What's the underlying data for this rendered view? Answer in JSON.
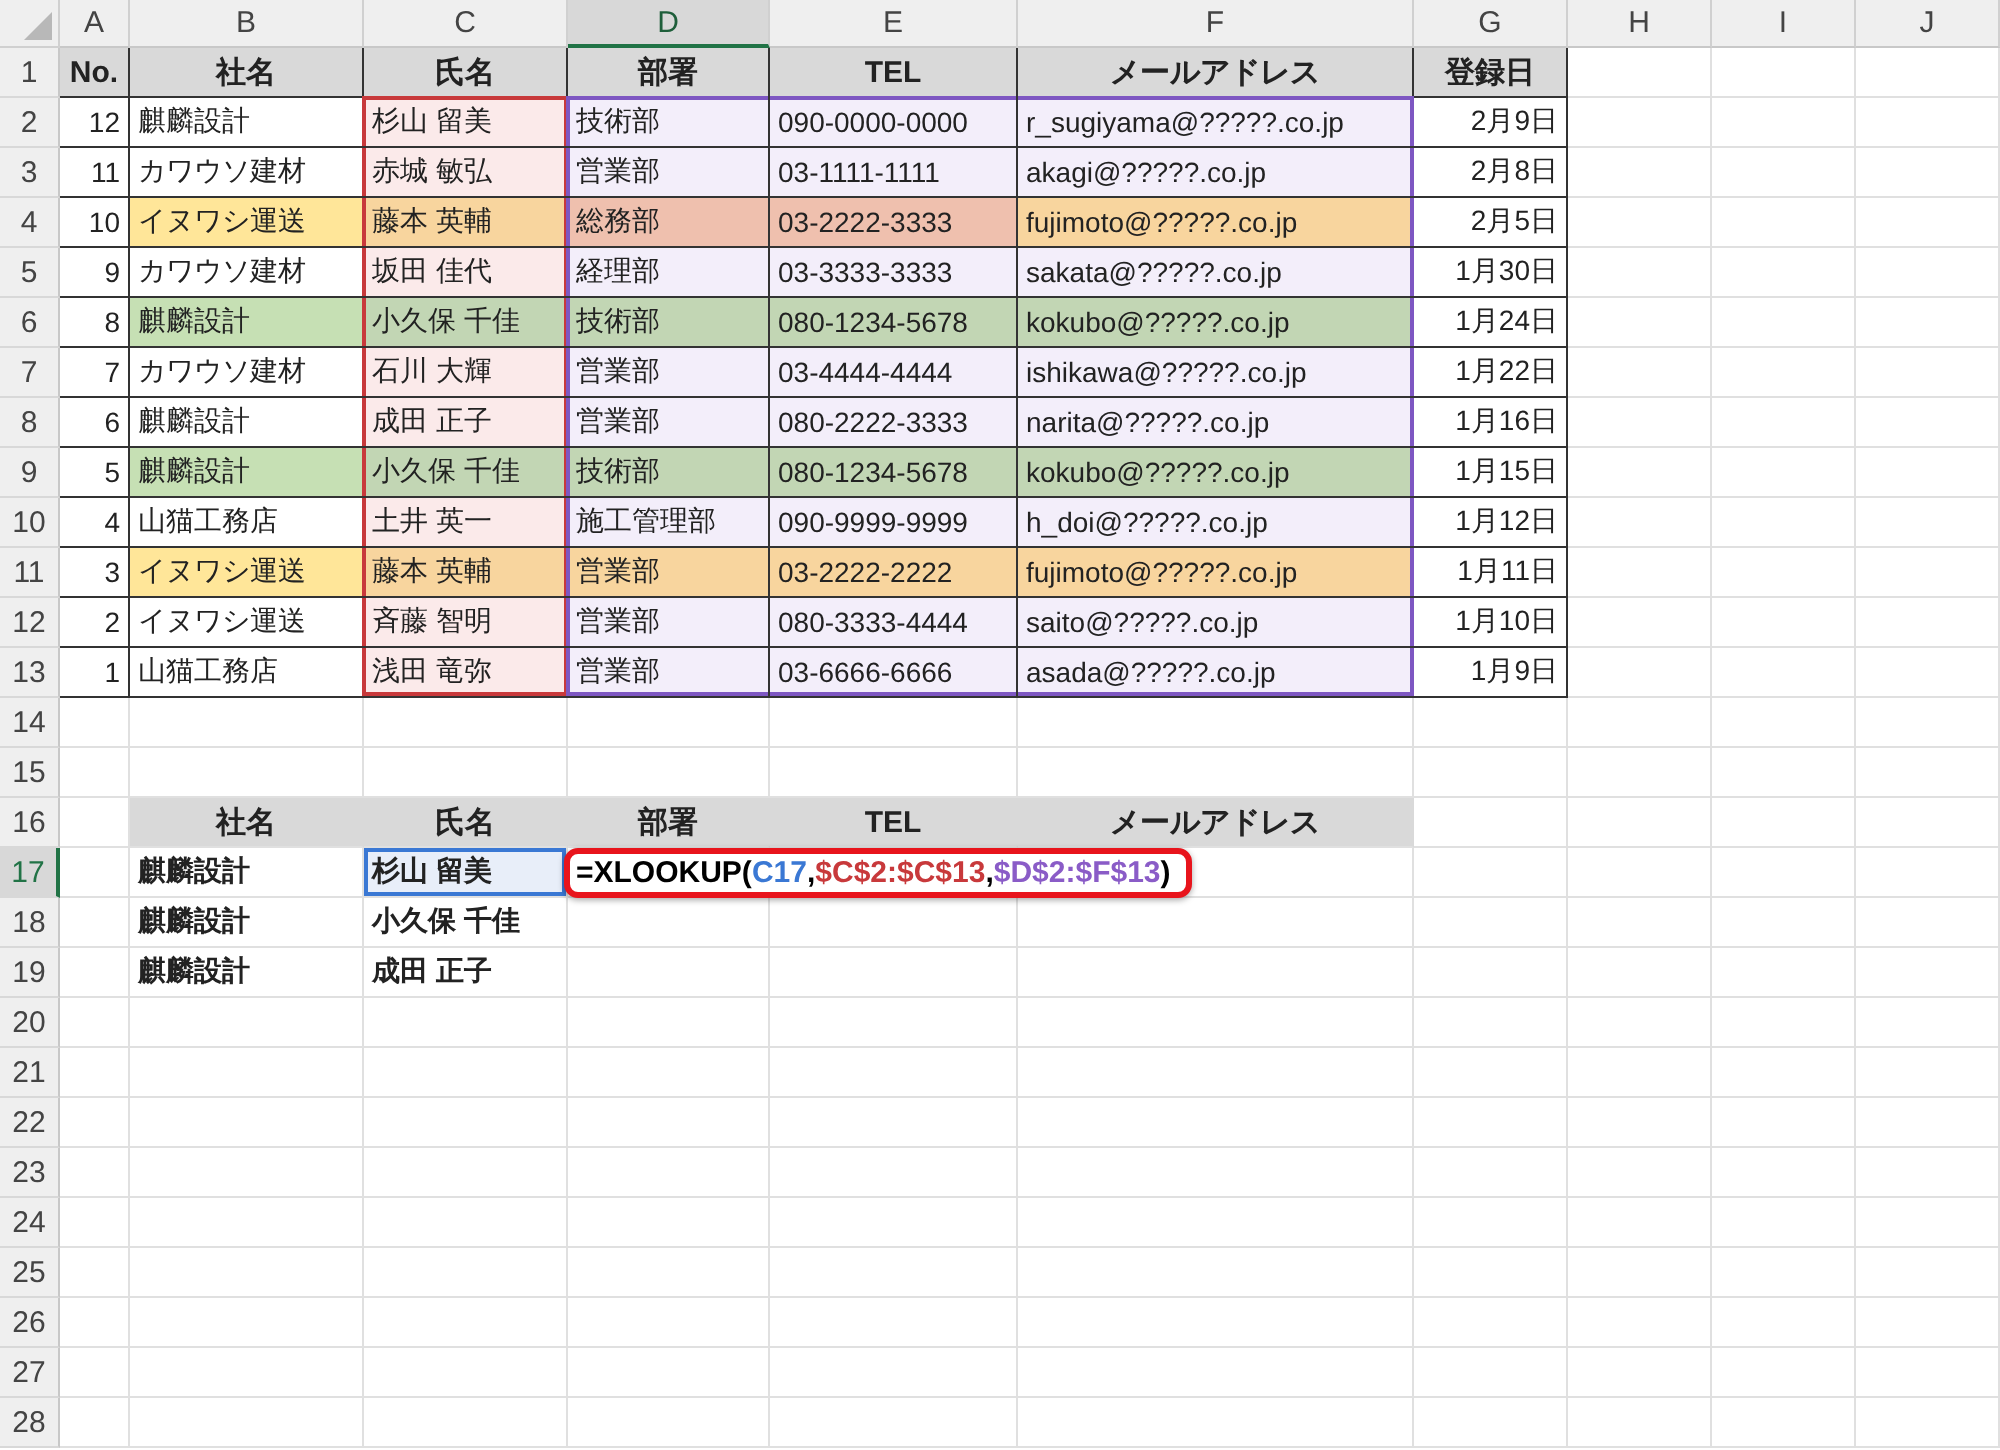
{
  "sheet": {
    "columns": [
      {
        "label": "A",
        "selected": false
      },
      {
        "label": "B",
        "selected": false
      },
      {
        "label": "C",
        "selected": false
      },
      {
        "label": "D",
        "selected": true
      },
      {
        "label": "E",
        "selected": false
      },
      {
        "label": "F",
        "selected": false
      },
      {
        "label": "G",
        "selected": false
      },
      {
        "label": "H",
        "selected": false
      },
      {
        "label": "I",
        "selected": false
      },
      {
        "label": "J",
        "selected": false
      }
    ],
    "rows": [
      {
        "number": "1",
        "selected": false,
        "kind": "header",
        "cells": {
          "A": {
            "text": "No."
          },
          "B": {
            "text": "社名"
          },
          "C": {
            "text": "氏名"
          },
          "D": {
            "text": "部署"
          },
          "E": {
            "text": "TEL"
          },
          "F": {
            "text": "メールアドレス"
          },
          "G": {
            "text": "登録日"
          }
        }
      },
      {
        "number": "2",
        "selected": false,
        "kind": "record",
        "cells": {
          "A": {
            "text": "12"
          },
          "B": {
            "text": "麒麟設計"
          },
          "C": {
            "text": "杉山 留美",
            "color": "#fbeaea",
            "ref": {
              "color": "#c8393b",
              "top": true,
              "left": true,
              "right": true
            }
          },
          "D": {
            "text": "技術部",
            "color": "#f3eefa",
            "ref": {
              "color": "#7e57c2",
              "top": true,
              "left": true
            }
          },
          "E": {
            "text": "090-0000-0000",
            "color": "#f3eefa",
            "ref": {
              "color": "#7e57c2",
              "top": true
            }
          },
          "F": {
            "text": "r_sugiyama@?????.co.jp",
            "color": "#f3eefa",
            "ref": {
              "color": "#7e57c2",
              "top": true,
              "right": true
            }
          },
          "G": {
            "text": "2月9日"
          }
        }
      },
      {
        "number": "3",
        "selected": false,
        "kind": "record",
        "cells": {
          "A": {
            "text": "11"
          },
          "B": {
            "text": "カワウソ建材"
          },
          "C": {
            "text": "赤城 敏弘",
            "color": "#fbeaea",
            "ref": {
              "color": "#c8393b",
              "left": true,
              "right": true
            }
          },
          "D": {
            "text": "営業部",
            "color": "#f3eefa",
            "ref": {
              "color": "#7e57c2",
              "left": true
            }
          },
          "E": {
            "text": "03-1111-1111",
            "color": "#f3eefa"
          },
          "F": {
            "text": "akagi@?????.co.jp",
            "color": "#f3eefa",
            "ref": {
              "color": "#7e57c2",
              "right": true
            }
          },
          "G": {
            "text": "2月8日"
          }
        }
      },
      {
        "number": "4",
        "selected": false,
        "kind": "record",
        "cells": {
          "A": {
            "text": "10"
          },
          "B": {
            "text": "イヌワシ運送",
            "color": "#ffe699"
          },
          "C": {
            "text": "藤本 英輔",
            "color": "#f8d59e",
            "ref": {
              "color": "#c8393b",
              "left": true,
              "right": true
            }
          },
          "D": {
            "text": "総務部",
            "color": "#efc0ae",
            "ref": {
              "color": "#7e57c2",
              "left": true
            }
          },
          "E": {
            "text": "03-2222-3333",
            "color": "#efc0ae"
          },
          "F": {
            "text": "fujimoto@?????.co.jp",
            "color": "#f8d59e",
            "ref": {
              "color": "#7e57c2",
              "right": true
            }
          },
          "G": {
            "text": "2月5日"
          }
        }
      },
      {
        "number": "5",
        "selected": false,
        "kind": "record",
        "cells": {
          "A": {
            "text": "9"
          },
          "B": {
            "text": "カワウソ建材"
          },
          "C": {
            "text": "坂田 佳代",
            "color": "#fbeaea",
            "ref": {
              "color": "#c8393b",
              "left": true,
              "right": true
            }
          },
          "D": {
            "text": "経理部",
            "color": "#f3eefa",
            "ref": {
              "color": "#7e57c2",
              "left": true
            }
          },
          "E": {
            "text": "03-3333-3333",
            "color": "#f3eefa"
          },
          "F": {
            "text": "sakata@?????.co.jp",
            "color": "#f3eefa",
            "ref": {
              "color": "#7e57c2",
              "right": true
            }
          },
          "G": {
            "text": "1月30日"
          }
        }
      },
      {
        "number": "6",
        "selected": false,
        "kind": "record",
        "cells": {
          "A": {
            "text": "8"
          },
          "B": {
            "text": "麒麟設計",
            "color": "#c6e0b4"
          },
          "C": {
            "text": "小久保 千佳",
            "color": "#c2d6b4",
            "ref": {
              "color": "#c8393b",
              "left": true,
              "right": true
            }
          },
          "D": {
            "text": "技術部",
            "color": "#c2d6b4",
            "ref": {
              "color": "#7e57c2",
              "left": true
            }
          },
          "E": {
            "text": "080-1234-5678",
            "color": "#c2d6b4"
          },
          "F": {
            "text": "kokubo@?????.co.jp",
            "color": "#c2d6b4",
            "ref": {
              "color": "#7e57c2",
              "right": true
            }
          },
          "G": {
            "text": "1月24日"
          }
        }
      },
      {
        "number": "7",
        "selected": false,
        "kind": "record",
        "cells": {
          "A": {
            "text": "7"
          },
          "B": {
            "text": "カワウソ建材"
          },
          "C": {
            "text": "石川 大輝",
            "color": "#fbeaea",
            "ref": {
              "color": "#c8393b",
              "left": true,
              "right": true
            }
          },
          "D": {
            "text": "営業部",
            "color": "#f3eefa",
            "ref": {
              "color": "#7e57c2",
              "left": true
            }
          },
          "E": {
            "text": "03-4444-4444",
            "color": "#f3eefa"
          },
          "F": {
            "text": "ishikawa@?????.co.jp",
            "color": "#f3eefa",
            "ref": {
              "color": "#7e57c2",
              "right": true
            }
          },
          "G": {
            "text": "1月22日"
          }
        }
      },
      {
        "number": "8",
        "selected": false,
        "kind": "record",
        "cells": {
          "A": {
            "text": "6"
          },
          "B": {
            "text": "麒麟設計"
          },
          "C": {
            "text": "成田 正子",
            "color": "#fbeaea",
            "ref": {
              "color": "#c8393b",
              "left": true,
              "right": true
            }
          },
          "D": {
            "text": "営業部",
            "color": "#f3eefa",
            "ref": {
              "color": "#7e57c2",
              "left": true
            }
          },
          "E": {
            "text": "080-2222-3333",
            "color": "#f3eefa"
          },
          "F": {
            "text": "narita@?????.co.jp",
            "color": "#f3eefa",
            "ref": {
              "color": "#7e57c2",
              "right": true
            }
          },
          "G": {
            "text": "1月16日"
          }
        }
      },
      {
        "number": "9",
        "selected": false,
        "kind": "record",
        "cells": {
          "A": {
            "text": "5"
          },
          "B": {
            "text": "麒麟設計",
            "color": "#c6e0b4"
          },
          "C": {
            "text": "小久保 千佳",
            "color": "#c2d6b4",
            "ref": {
              "color": "#c8393b",
              "left": true,
              "right": true
            }
          },
          "D": {
            "text": "技術部",
            "color": "#c2d6b4",
            "ref": {
              "color": "#7e57c2",
              "left": true
            }
          },
          "E": {
            "text": "080-1234-5678",
            "color": "#c2d6b4"
          },
          "F": {
            "text": "kokubo@?????.co.jp",
            "color": "#c2d6b4",
            "ref": {
              "color": "#7e57c2",
              "right": true
            }
          },
          "G": {
            "text": "1月15日"
          }
        }
      },
      {
        "number": "10",
        "selected": false,
        "kind": "record",
        "cells": {
          "A": {
            "text": "4"
          },
          "B": {
            "text": "山猫工務店"
          },
          "C": {
            "text": "土井 英一",
            "color": "#fbeaea",
            "ref": {
              "color": "#c8393b",
              "left": true,
              "right": true
            }
          },
          "D": {
            "text": "施工管理部",
            "color": "#f3eefa",
            "ref": {
              "color": "#7e57c2",
              "left": true
            }
          },
          "E": {
            "text": "090-9999-9999",
            "color": "#f3eefa"
          },
          "F": {
            "text": "h_doi@?????.co.jp",
            "color": "#f3eefa",
            "ref": {
              "color": "#7e57c2",
              "right": true
            }
          },
          "G": {
            "text": "1月12日"
          }
        }
      },
      {
        "number": "11",
        "selected": false,
        "kind": "record",
        "cells": {
          "A": {
            "text": "3"
          },
          "B": {
            "text": "イヌワシ運送",
            "color": "#ffe699"
          },
          "C": {
            "text": "藤本 英輔",
            "color": "#f8d59e",
            "ref": {
              "color": "#c8393b",
              "left": true,
              "right": true
            }
          },
          "D": {
            "text": "営業部",
            "color": "#f8d59e",
            "ref": {
              "color": "#7e57c2",
              "left": true
            }
          },
          "E": {
            "text": "03-2222-2222",
            "color": "#f8d59e"
          },
          "F": {
            "text": "fujimoto@?????.co.jp",
            "color": "#f8d59e",
            "ref": {
              "color": "#7e57c2",
              "right": true
            }
          },
          "G": {
            "text": "1月11日"
          }
        }
      },
      {
        "number": "12",
        "selected": false,
        "kind": "record",
        "cells": {
          "A": {
            "text": "2"
          },
          "B": {
            "text": "イヌワシ運送"
          },
          "C": {
            "text": "斉藤 智明",
            "color": "#fbeaea",
            "ref": {
              "color": "#c8393b",
              "left": true,
              "right": true
            }
          },
          "D": {
            "text": "営業部",
            "color": "#f3eefa",
            "ref": {
              "color": "#7e57c2",
              "left": true
            }
          },
          "E": {
            "text": "080-3333-4444",
            "color": "#f3eefa"
          },
          "F": {
            "text": "saito@?????.co.jp",
            "color": "#f3eefa",
            "ref": {
              "color": "#7e57c2",
              "right": true
            }
          },
          "G": {
            "text": "1月10日"
          }
        }
      },
      {
        "number": "13",
        "selected": false,
        "kind": "record",
        "cells": {
          "A": {
            "text": "1"
          },
          "B": {
            "text": "山猫工務店"
          },
          "C": {
            "text": "浅田 竜弥",
            "color": "#fbeaea",
            "ref": {
              "color": "#c8393b",
              "left": true,
              "right": true,
              "bottom": true
            }
          },
          "D": {
            "text": "営業部",
            "color": "#f3eefa",
            "ref": {
              "color": "#7e57c2",
              "left": true,
              "bottom": true
            }
          },
          "E": {
            "text": "03-6666-6666",
            "color": "#f3eefa",
            "ref": {
              "color": "#7e57c2",
              "bottom": true
            }
          },
          "F": {
            "text": "asada@?????.co.jp",
            "color": "#f3eefa",
            "ref": {
              "color": "#7e57c2",
              "right": true,
              "bottom": true
            }
          },
          "G": {
            "text": "1月9日"
          }
        }
      },
      {
        "number": "14",
        "selected": false,
        "kind": "blank"
      },
      {
        "number": "15",
        "selected": false,
        "kind": "blank"
      },
      {
        "number": "16",
        "selected": false,
        "kind": "lookup_header",
        "cells": {
          "B": {
            "text": "社名"
          },
          "C": {
            "text": "氏名"
          },
          "D": {
            "text": "部署"
          },
          "E": {
            "text": "TEL"
          },
          "F": {
            "text": "メールアドレス"
          }
        }
      },
      {
        "number": "17",
        "selected": true,
        "kind": "lookup",
        "cells": {
          "B": {
            "text": "麒麟設計"
          },
          "C": {
            "text": "杉山 留美",
            "selected": true
          },
          "D": {
            "formula": [
              {
                "text": "=XLOOKUP(",
                "color": "#000000"
              },
              {
                "text": "C17",
                "color": "#3a78d4"
              },
              {
                "text": ",",
                "color": "#000000"
              },
              {
                "text": "$C$2:$C$13",
                "color": "#c8393b"
              },
              {
                "text": ",",
                "color": "#000000"
              },
              {
                "text": "$D$2:$F$13",
                "color": "#8a5cc7"
              },
              {
                "text": ")",
                "color": "#000000"
              }
            ]
          }
        }
      },
      {
        "number": "18",
        "selected": false,
        "kind": "lookup",
        "cells": {
          "B": {
            "text": "麒麟設計"
          },
          "C": {
            "text": "小久保 千佳",
            "selected": false
          }
        }
      },
      {
        "number": "19",
        "selected": false,
        "kind": "lookup",
        "cells": {
          "B": {
            "text": "麒麟設計"
          },
          "C": {
            "text": "成田 正子",
            "selected": false
          }
        }
      },
      {
        "number": "20",
        "selected": false,
        "kind": "blank"
      },
      {
        "number": "21",
        "selected": false,
        "kind": "blank"
      },
      {
        "number": "22",
        "selected": false,
        "kind": "blank"
      },
      {
        "number": "23",
        "selected": false,
        "kind": "blank"
      },
      {
        "number": "24",
        "selected": false,
        "kind": "blank"
      },
      {
        "number": "25",
        "selected": false,
        "kind": "blank"
      },
      {
        "number": "26",
        "selected": false,
        "kind": "blank"
      },
      {
        "number": "27",
        "selected": false,
        "kind": "blank"
      },
      {
        "number": "28",
        "selected": false,
        "kind": "blank"
      }
    ]
  }
}
